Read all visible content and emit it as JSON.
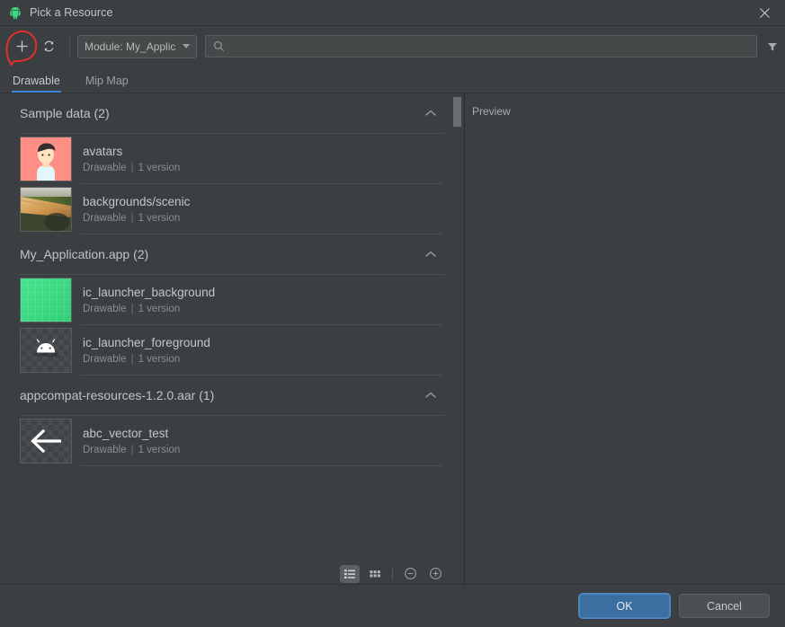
{
  "window": {
    "title": "Pick a Resource",
    "app_icon": "android-icon",
    "close_icon": "close-icon"
  },
  "toolbar": {
    "add_icon": "plus-icon",
    "add_label": "+",
    "refresh_icon": "refresh-icon",
    "module_select_label": "Module: My_Applica",
    "module_caret_icon": "chevron-down-icon",
    "search_icon": "search-icon",
    "search_value": "",
    "search_placeholder": "",
    "filter_icon": "filter-icon",
    "annotation_color": "#e03030"
  },
  "tabs": [
    {
      "label": "Drawable",
      "active": true
    },
    {
      "label": "Mip Map",
      "active": false
    }
  ],
  "sections": [
    {
      "title": "Sample data (2)",
      "collapse_icon": "chevron-up-icon",
      "items": [
        {
          "name": "avatars",
          "type": "Drawable",
          "versions": "1 version",
          "thumb": "avatar-art"
        },
        {
          "name": "backgrounds/scenic",
          "type": "Drawable",
          "versions": "1 version",
          "thumb": "scenic-art"
        }
      ]
    },
    {
      "title": "My_Application.app (2)",
      "collapse_icon": "chevron-up-icon",
      "items": [
        {
          "name": "ic_launcher_background",
          "type": "Drawable",
          "versions": "1 version",
          "thumb": "green-art"
        },
        {
          "name": "ic_launcher_foreground",
          "type": "Drawable",
          "versions": "1 version",
          "thumb": "android-head-art"
        }
      ]
    },
    {
      "title": "appcompat-resources-1.2.0.aar (1)",
      "collapse_icon": "chevron-up-icon",
      "items": [
        {
          "name": "abc_vector_test",
          "type": "Drawable",
          "versions": "1 version",
          "thumb": "back-arrow-art"
        }
      ]
    }
  ],
  "list_footer": {
    "list_view_icon": "list-view-icon",
    "grid_view_icon": "grid-view-icon",
    "zoom_out_icon": "circle-minus-icon",
    "zoom_in_icon": "circle-plus-icon",
    "selected_view": "list"
  },
  "preview": {
    "label": "Preview"
  },
  "dialog_footer": {
    "ok_label": "OK",
    "cancel_label": "Cancel",
    "ok_color": "#3c6ea0"
  },
  "separator": "|"
}
